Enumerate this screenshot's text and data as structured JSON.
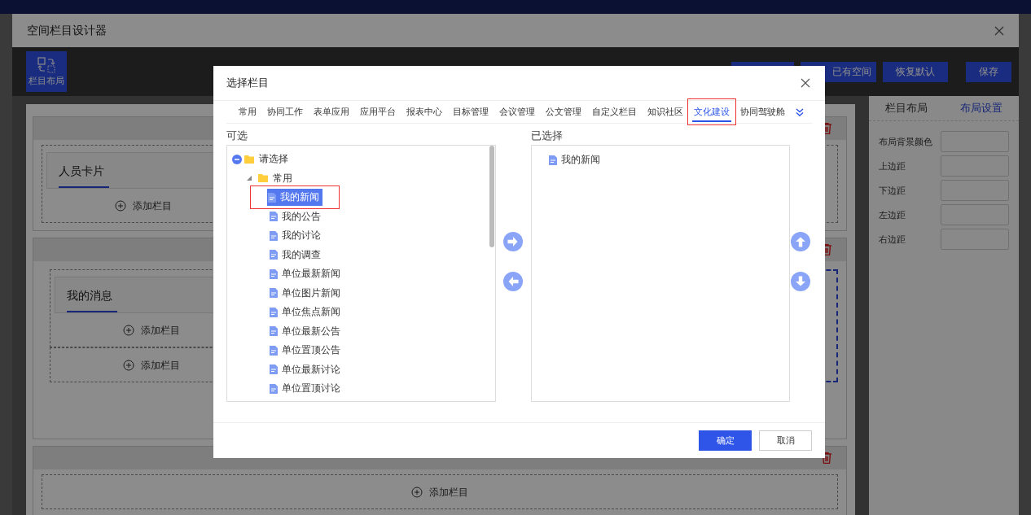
{
  "designer": {
    "title": "空间栏目设计器",
    "toolbar": {
      "layout_button": "栏目布局",
      "buttons": [
        {
          "label": "已有空间",
          "kind": "partial"
        },
        {
          "label": "恢复默认",
          "kind": "normal"
        },
        {
          "label": "保存",
          "kind": "normal"
        }
      ]
    },
    "canvas": {
      "sections": [
        {
          "slots": [
            {
              "card_title": "人员卡片",
              "add_label": "添加栏目"
            }
          ],
          "full": false
        },
        {
          "slots": [
            {
              "card_title": "我的消息",
              "add_label": "添加栏目"
            },
            {
              "add_label": "添加栏目"
            }
          ],
          "full": false
        },
        {
          "slots": [
            {
              "add_label": "添加栏目"
            }
          ],
          "full": true
        }
      ]
    },
    "side_panel": {
      "tabs": [
        {
          "label": "栏目布局",
          "selected": false
        },
        {
          "label": "布局设置",
          "selected": true
        }
      ],
      "fields": [
        "布局背景颜色",
        "上边距",
        "下边距",
        "左边距",
        "右边距"
      ]
    }
  },
  "dialog": {
    "title": "选择栏目",
    "tabs": [
      {
        "label": "常用",
        "selected": false,
        "highlighted": false
      },
      {
        "label": "协同工作",
        "selected": false,
        "highlighted": false
      },
      {
        "label": "表单应用",
        "selected": false,
        "highlighted": false
      },
      {
        "label": "应用平台",
        "selected": false,
        "highlighted": false
      },
      {
        "label": "报表中心",
        "selected": false,
        "highlighted": false
      },
      {
        "label": "目标管理",
        "selected": false,
        "highlighted": false
      },
      {
        "label": "会议管理",
        "selected": false,
        "highlighted": false
      },
      {
        "label": "公文管理",
        "selected": false,
        "highlighted": false
      },
      {
        "label": "自定义栏目",
        "selected": false,
        "highlighted": false
      },
      {
        "label": "知识社区",
        "selected": false,
        "highlighted": false
      },
      {
        "label": "文化建设",
        "selected": true,
        "highlighted": true
      },
      {
        "label": "协同驾驶舱",
        "selected": false,
        "highlighted": false
      }
    ],
    "available_label": "可选",
    "chosen_label": "已选择",
    "tree": [
      {
        "label": "请选择",
        "kind": "folder",
        "expanded": true,
        "children": [
          {
            "label": "常用",
            "kind": "folder",
            "expanded": true,
            "children": [
              {
                "label": "我的新闻",
                "kind": "file",
                "selected": true,
                "highlighted": true
              },
              {
                "label": "我的公告",
                "kind": "file",
                "selected": false,
                "highlighted": false
              },
              {
                "label": "我的讨论",
                "kind": "file",
                "selected": false,
                "highlighted": false
              },
              {
                "label": "我的调查",
                "kind": "file",
                "selected": false,
                "highlighted": false
              },
              {
                "label": "单位最新新闻",
                "kind": "file",
                "selected": false,
                "highlighted": false
              },
              {
                "label": "单位图片新闻",
                "kind": "file",
                "selected": false,
                "highlighted": false
              },
              {
                "label": "单位焦点新闻",
                "kind": "file",
                "selected": false,
                "highlighted": false
              },
              {
                "label": "单位最新公告",
                "kind": "file",
                "selected": false,
                "highlighted": false
              },
              {
                "label": "单位置顶公告",
                "kind": "file",
                "selected": false,
                "highlighted": false
              },
              {
                "label": "单位最新讨论",
                "kind": "file",
                "selected": false,
                "highlighted": false
              },
              {
                "label": "单位置顶讨论",
                "kind": "file",
                "selected": false,
                "highlighted": false
              }
            ]
          }
        ]
      }
    ],
    "chosen_items": [
      "我的新闻"
    ],
    "confirm": "确定",
    "cancel": "取消"
  }
}
